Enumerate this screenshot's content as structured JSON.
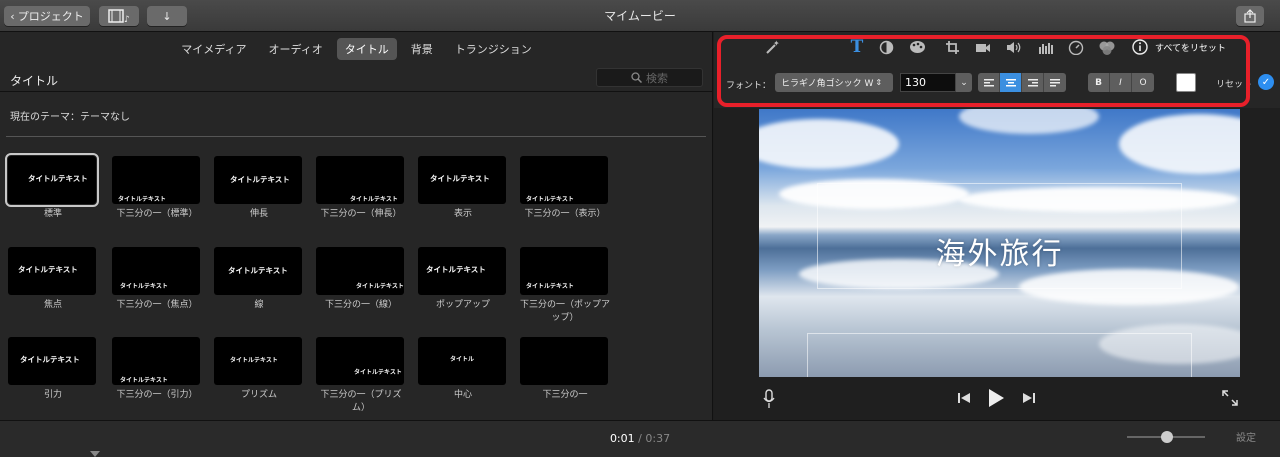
{
  "titlebar": {
    "back_label": "プロジェクト",
    "window_title": "マイムービー"
  },
  "media_tabs": [
    {
      "label": "マイメディア",
      "active": false
    },
    {
      "label": "オーディオ",
      "active": false
    },
    {
      "label": "タイトル",
      "active": true
    },
    {
      "label": "背景",
      "active": false
    },
    {
      "label": "トランジション",
      "active": false
    }
  ],
  "browser": {
    "section_title": "タイトル",
    "search_placeholder": "検索",
    "theme_label": "現在のテーマ：テーマなし"
  },
  "titles": [
    {
      "label": "標準",
      "text": "タイトルテキスト",
      "selected": true
    },
    {
      "label": "下三分の一（標準）",
      "text": "タイトルテキスト"
    },
    {
      "label": "伸長",
      "text": "タイトルテキスト"
    },
    {
      "label": "下三分の一（伸長）",
      "text": "タイトルテキスト"
    },
    {
      "label": "表示",
      "text": "タイトルテキスト"
    },
    {
      "label": "下三分の一（表示）",
      "text": "タイトルテキスト"
    },
    {
      "label": "焦点",
      "text": "タイトルテキスト"
    },
    {
      "label": "下三分の一（焦点）",
      "text": "タイトルテキスト"
    },
    {
      "label": "線",
      "text": "タイトルテキスト"
    },
    {
      "label": "下三分の一（線）",
      "text": "タイトルテキスト"
    },
    {
      "label": "ポップアップ",
      "text": "タイトルテキスト"
    },
    {
      "label": "下三分の一（ポップアップ）",
      "text": "タイトルテキスト"
    },
    {
      "label": "引力",
      "text": "タイトルテキスト"
    },
    {
      "label": "下三分の一（引力）",
      "text": "タイトルテキスト"
    },
    {
      "label": "プリズム",
      "text": "タイトルテキスト"
    },
    {
      "label": "下三分の一（プリズム）",
      "text": "タイトルテキスト"
    },
    {
      "label": "中心",
      "text": "タイトル"
    },
    {
      "label": "下三分の一",
      "text": ""
    }
  ],
  "inspector": {
    "reset_all_label": "すべてをリセット",
    "font_label": "フォント：",
    "font_name": "ヒラギノ角ゴシック W",
    "font_size": "130",
    "style_bold": "B",
    "style_italic": "I",
    "style_outline": "O",
    "text_color": "#ffffff",
    "reset_label": "リセット",
    "icons": [
      "magic-wand-icon",
      "text-icon",
      "color-balance-icon",
      "palette-icon",
      "crop-icon",
      "camera-icon",
      "volume-icon",
      "equalizer-icon",
      "speedometer-icon",
      "filter-icon",
      "info-icon"
    ]
  },
  "viewer": {
    "title_text": "海外旅行"
  },
  "timeline": {
    "current_time": "0:01",
    "separator": "/",
    "total_time": "0:37",
    "settings_label": "設定",
    "zoom_level": 0.5
  },
  "colors": {
    "highlight": "#e8202a",
    "accent": "#3b8fe0"
  }
}
